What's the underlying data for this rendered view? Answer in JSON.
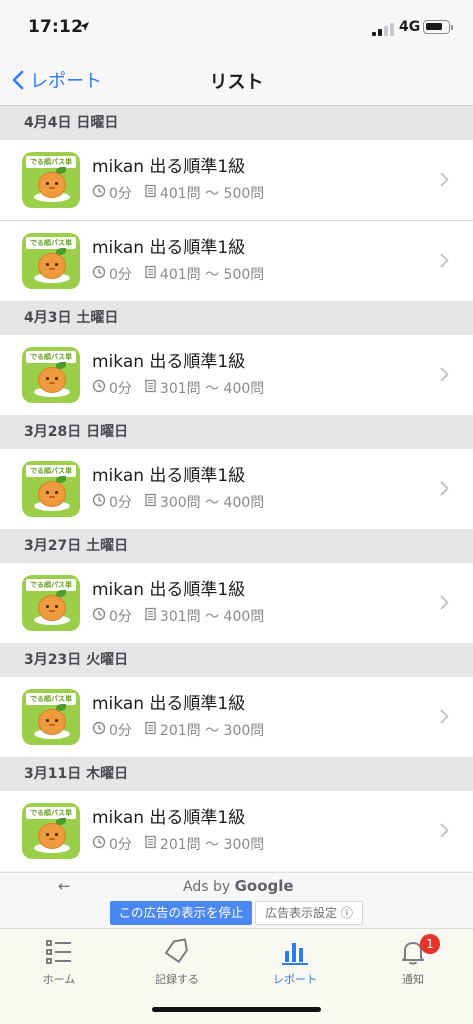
{
  "status_bar": {
    "time": "17:12",
    "network": "4G"
  },
  "nav": {
    "back_label": "レポート",
    "title": "リスト"
  },
  "sections": [
    {
      "date": "4月4日 日曜日",
      "rows": [
        {
          "title": "mikan 出る順準1級",
          "time": "0分",
          "range": "401問 〜 500問"
        },
        {
          "title": "mikan 出る順準1級",
          "time": "0分",
          "range": "401問 〜 500問"
        }
      ]
    },
    {
      "date": "4月3日 土曜日",
      "rows": [
        {
          "title": "mikan 出る順準1級",
          "time": "0分",
          "range": "301問 〜 400問"
        }
      ]
    },
    {
      "date": "3月28日 日曜日",
      "rows": [
        {
          "title": "mikan 出る順準1級",
          "time": "0分",
          "range": "300問 〜 400問"
        }
      ]
    },
    {
      "date": "3月27日 土曜日",
      "rows": [
        {
          "title": "mikan 出る順準1級",
          "time": "0分",
          "range": "301問 〜 400問"
        }
      ]
    },
    {
      "date": "3月23日 火曜日",
      "rows": [
        {
          "title": "mikan 出る順準1級",
          "time": "0分",
          "range": "201問 〜 300問"
        }
      ]
    },
    {
      "date": "3月11日 木曜日",
      "rows": [
        {
          "title": "mikan 出る順準1級",
          "time": "0分",
          "range": "201問 〜 300問"
        }
      ]
    }
  ],
  "app_icon": {
    "banner_text": "でる順パス単"
  },
  "ad": {
    "back_arrow": "←",
    "ads_by": "Ads by",
    "google": "Google",
    "stop_label": "この広告の表示を停止",
    "settings_label": "広告表示設定 ⓘ"
  },
  "tabs": [
    {
      "label": "ホーム",
      "icon": "list-icon"
    },
    {
      "label": "記録する",
      "icon": "tag-icon"
    },
    {
      "label": "レポート",
      "icon": "bar-chart-icon",
      "active": true
    },
    {
      "label": "通知",
      "icon": "bell-icon",
      "badge": "1"
    }
  ],
  "colors": {
    "accent": "#2f7bf6",
    "badge": "#e8332a",
    "icon_bg": "#9bcf4a"
  }
}
